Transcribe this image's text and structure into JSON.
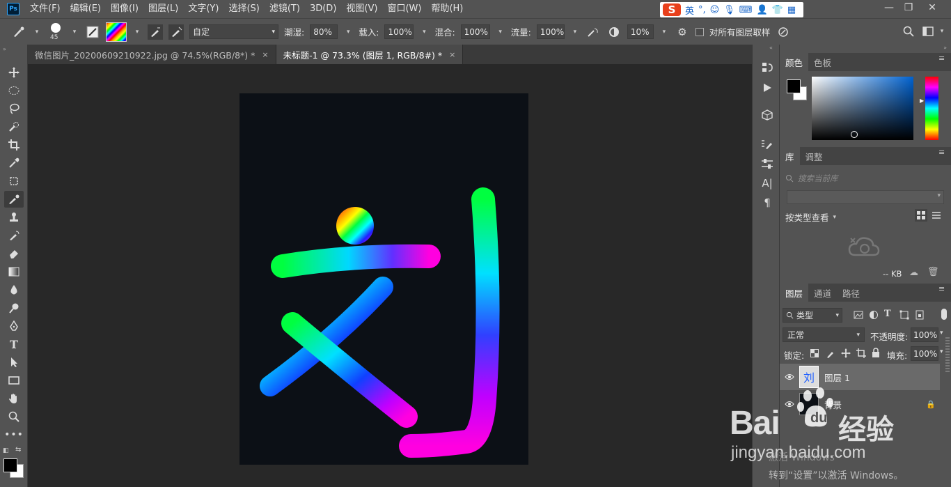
{
  "app": {
    "logo": "Ps"
  },
  "menu": {
    "items": [
      "文件(F)",
      "编辑(E)",
      "图像(I)",
      "图层(L)",
      "文字(Y)",
      "选择(S)",
      "滤镜(T)",
      "3D(D)",
      "视图(V)",
      "窗口(W)",
      "帮助(H)"
    ]
  },
  "ime": {
    "logo": "S",
    "mode": "英"
  },
  "options": {
    "brush_size": "45",
    "mode_value": "自定",
    "wet_label": "潮湿:",
    "wet_value": "80%",
    "load_label": "载入:",
    "load_value": "100%",
    "mix_label": "混合:",
    "mix_value": "100%",
    "flow_label": "流量:",
    "flow_value": "100%",
    "angle_value": "10%",
    "sample_all_label": "对所有图层取样"
  },
  "tabs": [
    {
      "label": "微信图片_20200609210922.jpg @ 74.5%(RGB/8*) *",
      "close": "×",
      "active": false
    },
    {
      "label": "未标题-1 @ 73.3% (图层 1, RGB/8#) *",
      "close": "×",
      "active": true
    }
  ],
  "panels": {
    "color": {
      "tabs": [
        "颜色",
        "色板"
      ]
    },
    "library": {
      "tabs": [
        "库",
        "调整"
      ],
      "search_placeholder": "搜索当前库",
      "view_label": "按类型查看",
      "size_label": "-- KB"
    },
    "layers": {
      "tabs": [
        "图层",
        "通道",
        "路径"
      ],
      "filter_label": "类型",
      "blend_mode": "正常",
      "opacity_label": "不透明度:",
      "opacity_value": "100%",
      "lock_label": "锁定:",
      "fill_label": "填充:",
      "fill_value": "100%",
      "items": [
        {
          "name": "图层 1",
          "selected": true
        },
        {
          "name": "背景",
          "selected": false
        }
      ]
    }
  },
  "overlay": {
    "baidu_text": "Bai",
    "baidu_text2": "经验",
    "baidu_url": "jingyan.baidu.com",
    "activate_line1": "激活 Windows",
    "activate_line2": "转到“设置”以激活 Windows。"
  },
  "colors": {
    "ui_dark": "#535353",
    "canvas_bg": "#282828",
    "doc_bg": "#0c1016",
    "accent": "#31a8ff"
  }
}
